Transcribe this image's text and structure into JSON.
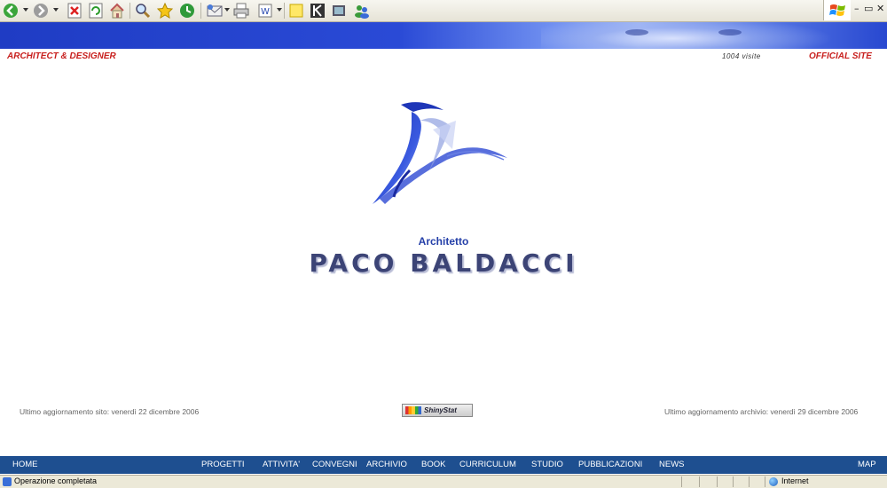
{
  "browser": {
    "toolbar_icons": [
      "back-icon",
      "forward-icon",
      "stop-icon",
      "refresh-icon",
      "home-icon",
      "search-icon",
      "favorites-icon",
      "history-icon",
      "mail-icon",
      "print-icon",
      "word-icon",
      "notes-icon",
      "k-icon",
      "media-icon",
      "messenger-icon"
    ],
    "window_controls": [
      "–",
      "▭",
      "✕"
    ]
  },
  "header": {
    "left": "ARCHITECT & DESIGNER",
    "visits": "1004  visite",
    "right": "OFFICIAL SITE"
  },
  "hero": {
    "subtitle": "Architetto",
    "name": "PACO BALDACCI"
  },
  "updates": {
    "site": "Ultimo aggiornamento sito: venerdì 22 dicembre 2006",
    "archive": "Ultimo aggiornamento archivio: venerdì 29 dicembre 2006",
    "counter_badge": "ShinyStat"
  },
  "nav": {
    "items": [
      "HOME",
      "PROGETTI",
      "ATTIVITA'",
      "CONVEGNI",
      "ARCHIVIO",
      "BOOK",
      "CURRICULUM",
      "STUDIO",
      "PUBBLICAZIONI",
      "NEWS",
      "MAP"
    ]
  },
  "status": {
    "text": "Operazione completata",
    "zone": "Internet"
  },
  "colors": {
    "nav_bg": "#1e4f90",
    "header_red": "#c8201e",
    "title_blue": "#243fa8"
  }
}
